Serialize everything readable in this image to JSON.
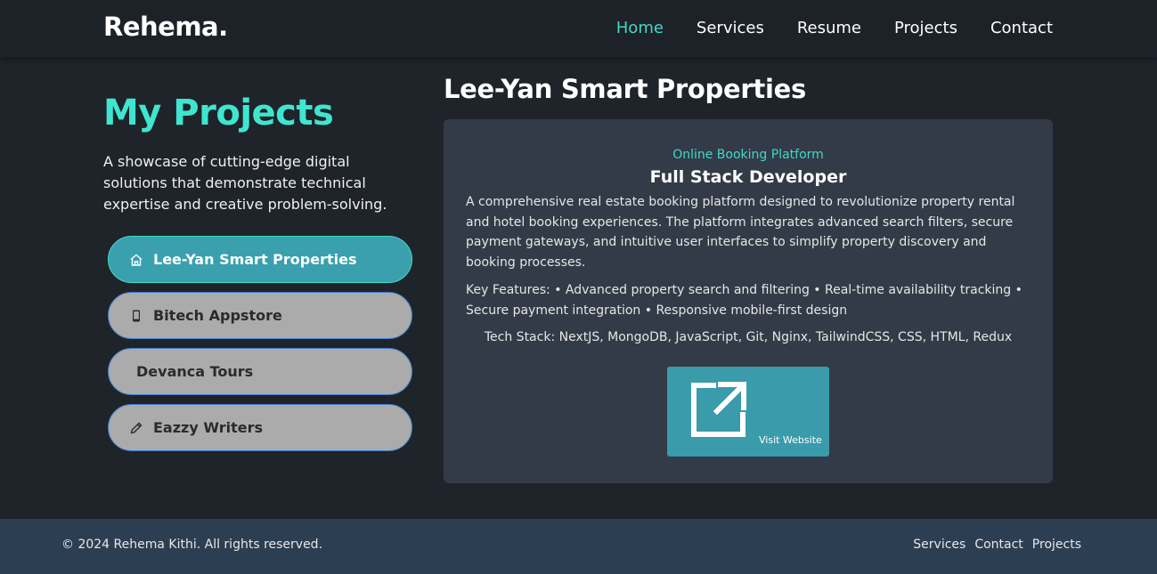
{
  "header": {
    "logo": "Rehema.",
    "nav": [
      {
        "label": "Home",
        "active": true
      },
      {
        "label": "Services",
        "active": false
      },
      {
        "label": "Resume",
        "active": false
      },
      {
        "label": "Projects",
        "active": false
      },
      {
        "label": "Contact",
        "active": false
      }
    ]
  },
  "sidebar": {
    "title": "My Projects",
    "description": "A showcase of cutting-edge digital solutions that demonstrate technical expertise and creative problem-solving.",
    "projects": [
      {
        "label": "Lee-Yan Smart Properties",
        "icon": "home-icon",
        "active": true
      },
      {
        "label": "Bitech Appstore",
        "icon": "mobile-icon",
        "active": false
      },
      {
        "label": "Devanca Tours",
        "icon": "",
        "active": false
      },
      {
        "label": "Eazzy Writers",
        "icon": "pencil-icon",
        "active": false
      }
    ]
  },
  "detail": {
    "title": "Lee-Yan Smart Properties",
    "category": "Online Booking Platform",
    "role": "Full Stack Developer",
    "description": "A comprehensive real estate booking platform designed to revolutionize property rental and hotel booking experiences. The platform integrates advanced search filters, secure payment gateways, and intuitive user interfaces to simplify property discovery and booking processes.",
    "features": "Key Features: • Advanced property search and filtering • Real-time availability tracking • Secure payment integration • Responsive mobile-first design",
    "tech_stack": "Tech Stack: NextJS, MongoDB, JavaScript, Git, Nginx, TailwindCSS, CSS, HTML, Redux",
    "visit_label": "Visit Website",
    "visit_icon": "external-link-icon"
  },
  "footer": {
    "copyright": "© 2024 Rehema Kithi. All rights reserved.",
    "links": [
      "Services",
      "Contact",
      "Projects"
    ]
  },
  "colors": {
    "accent": "#3fd9c5",
    "active_button": "#3aa0ae",
    "inactive_button": "#ababab",
    "card_bg": "#333b48",
    "page_bg": "#1f232a",
    "footer_bg": "#2c3e52"
  }
}
